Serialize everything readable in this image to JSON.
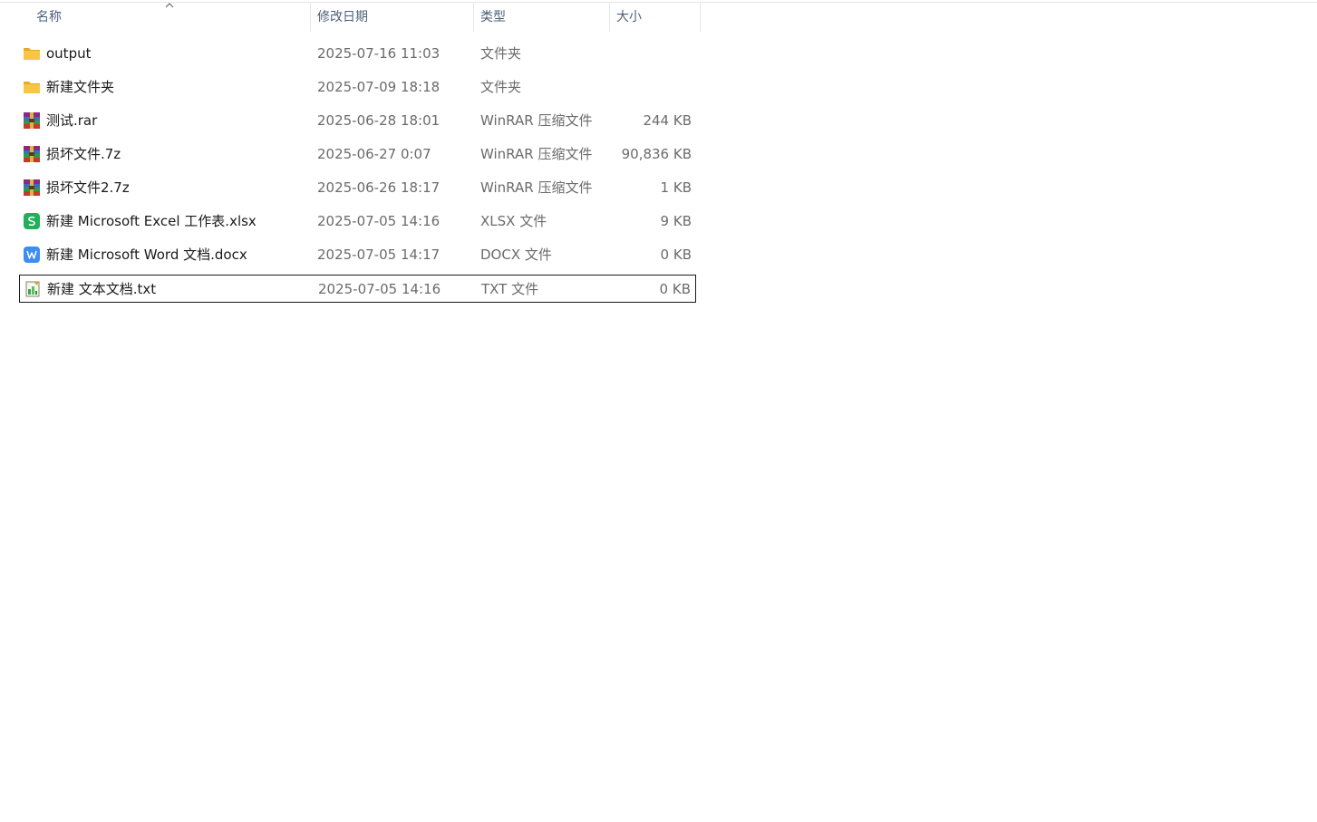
{
  "columns": {
    "name": "名称",
    "date": "修改日期",
    "type": "类型",
    "size": "大小"
  },
  "sort": {
    "column": "name",
    "icon": "chevron-up-icon"
  },
  "files": [
    {
      "name": "output",
      "date": "2025-07-16 11:03",
      "type": "文件夹",
      "size": "",
      "icon": "folder-icon"
    },
    {
      "name": "新建文件夹",
      "date": "2025-07-09 18:18",
      "type": "文件夹",
      "size": "",
      "icon": "folder-icon"
    },
    {
      "name": "测试.rar",
      "date": "2025-06-28 18:01",
      "type": "WinRAR 压缩文件",
      "size": "244 KB",
      "icon": "winrar-icon"
    },
    {
      "name": "损坏文件.7z",
      "date": "2025-06-27 0:07",
      "type": "WinRAR 压缩文件",
      "size": "90,836 KB",
      "icon": "winrar-icon"
    },
    {
      "name": "损坏文件2.7z",
      "date": "2025-06-26 18:17",
      "type": "WinRAR 压缩文件",
      "size": "1 KB",
      "icon": "winrar-icon"
    },
    {
      "name": "新建 Microsoft Excel 工作表.xlsx",
      "date": "2025-07-05 14:16",
      "type": "XLSX 文件",
      "size": "9 KB",
      "icon": "excel-icon"
    },
    {
      "name": "新建 Microsoft Word 文档.docx",
      "date": "2025-07-05 14:17",
      "type": "DOCX 文件",
      "size": "0 KB",
      "icon": "word-icon"
    },
    {
      "name": "新建 文本文档.txt",
      "date": "2025-07-05 14:16",
      "type": "TXT 文件",
      "size": "0 KB",
      "icon": "text-file-icon"
    }
  ],
  "focused_index": 7,
  "colors": {
    "header_text": "#4c607a",
    "folder": "#f8c642",
    "excel": "#21b05a",
    "word": "#3d8ef0"
  }
}
